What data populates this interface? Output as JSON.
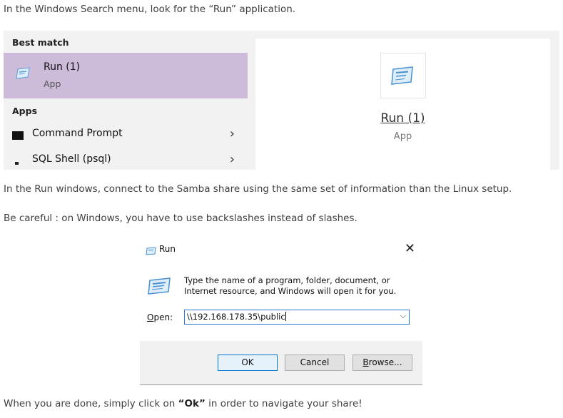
{
  "instructions": {
    "intro": "In the Windows Search menu, look for the “Run” application.",
    "connect": "In the Run windows, connect to the Samba share using the same set of information than the Linux setup.",
    "careful": "Be careful : on Windows, you have to use backslashes instead of slashes.",
    "done_prefix": "When you are done, simply click on ",
    "done_bold": "“Ok”",
    "done_suffix": " in order to navigate your share!"
  },
  "search_menu": {
    "best_match_header": "Best match",
    "best_match": {
      "title": "Run (1)",
      "subtitle": "App",
      "icon": "run-icon"
    },
    "apps_header": "Apps",
    "apps": [
      {
        "label": "Command Prompt",
        "icon": "command-prompt-icon"
      },
      {
        "label": "SQL Shell (psql)",
        "icon": "sql-shell-icon"
      }
    ],
    "preview": {
      "title": "Run (1)",
      "subtitle": "App",
      "icon": "run-icon"
    },
    "colors": {
      "highlight": "#cdbcd9",
      "background": "#f2f2f2"
    }
  },
  "run_dialog": {
    "title": "Run",
    "description": "Type the name of a program, folder, document, or Internet resource, and Windows will open it for you.",
    "open_label": "Open:",
    "open_value": "\\\\192.168.178.35\\public",
    "buttons": {
      "ok": "OK",
      "cancel": "Cancel",
      "browse": "Browse..."
    },
    "colors": {
      "focus": "#0078d7"
    }
  }
}
